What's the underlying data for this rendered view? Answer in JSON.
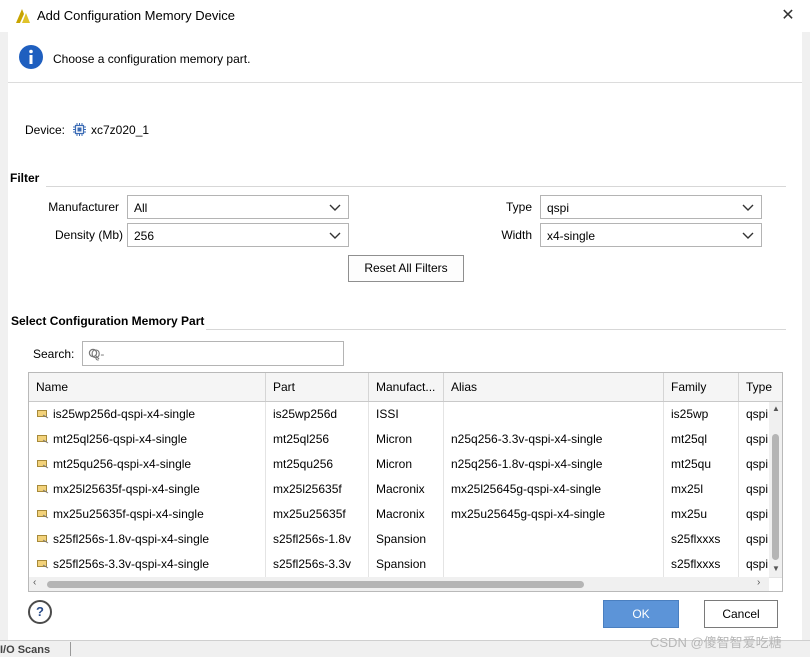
{
  "window": {
    "title": "Add Configuration Memory Device",
    "close_glyph": "✕"
  },
  "info": {
    "message": "Choose a configuration memory part."
  },
  "device": {
    "label": "Device:",
    "value": "xc7z020_1"
  },
  "filter": {
    "title": "Filter",
    "manufacturer_label": "Manufacturer",
    "manufacturer_value": "All",
    "density_label": "Density (Mb)",
    "density_value": "256",
    "type_label": "Type",
    "type_value": "qspi",
    "width_label": "Width",
    "width_value": "x4-single",
    "reset_label": "Reset All Filters"
  },
  "select_section": {
    "title": "Select Configuration Memory Part"
  },
  "search": {
    "label": "Search:",
    "placeholder": "Q-"
  },
  "table": {
    "headers": [
      "Name",
      "Part",
      "Manufact...",
      "Alias",
      "Family",
      "Type"
    ],
    "rows": [
      [
        "is25wp256d-qspi-x4-single",
        "is25wp256d",
        "ISSI",
        "",
        "is25wp",
        "qspi"
      ],
      [
        "mt25ql256-qspi-x4-single",
        "mt25ql256",
        "Micron",
        "n25q256-3.3v-qspi-x4-single",
        "mt25ql",
        "qspi"
      ],
      [
        "mt25qu256-qspi-x4-single",
        "mt25qu256",
        "Micron",
        "n25q256-1.8v-qspi-x4-single",
        "mt25qu",
        "qspi"
      ],
      [
        "mx25l25635f-qspi-x4-single",
        "mx25l25635f",
        "Macronix",
        "mx25l25645g-qspi-x4-single",
        "mx25l",
        "qspi"
      ],
      [
        "mx25u25635f-qspi-x4-single",
        "mx25u25635f",
        "Macronix",
        "mx25u25645g-qspi-x4-single",
        "mx25u",
        "qspi"
      ],
      [
        "s25fl256s-1.8v-qspi-x4-single",
        "s25fl256s-1.8v",
        "Spansion",
        "",
        "s25flxxxs",
        "qspi"
      ],
      [
        "s25fl256s-3.3v-qspi-x4-single",
        "s25fl256s-3.3v",
        "Spansion",
        "",
        "s25flxxxs",
        "qspi"
      ]
    ]
  },
  "buttons": {
    "help": "?",
    "ok": "OK",
    "cancel": "Cancel"
  },
  "background": {
    "tab_label": "I/O Scans"
  },
  "watermark": "CSDN @傻智智爱吃糖",
  "colors": {
    "ok_button": "#5c94d8",
    "info_icon": "#1f5fbf",
    "logo": "#c8a400"
  }
}
